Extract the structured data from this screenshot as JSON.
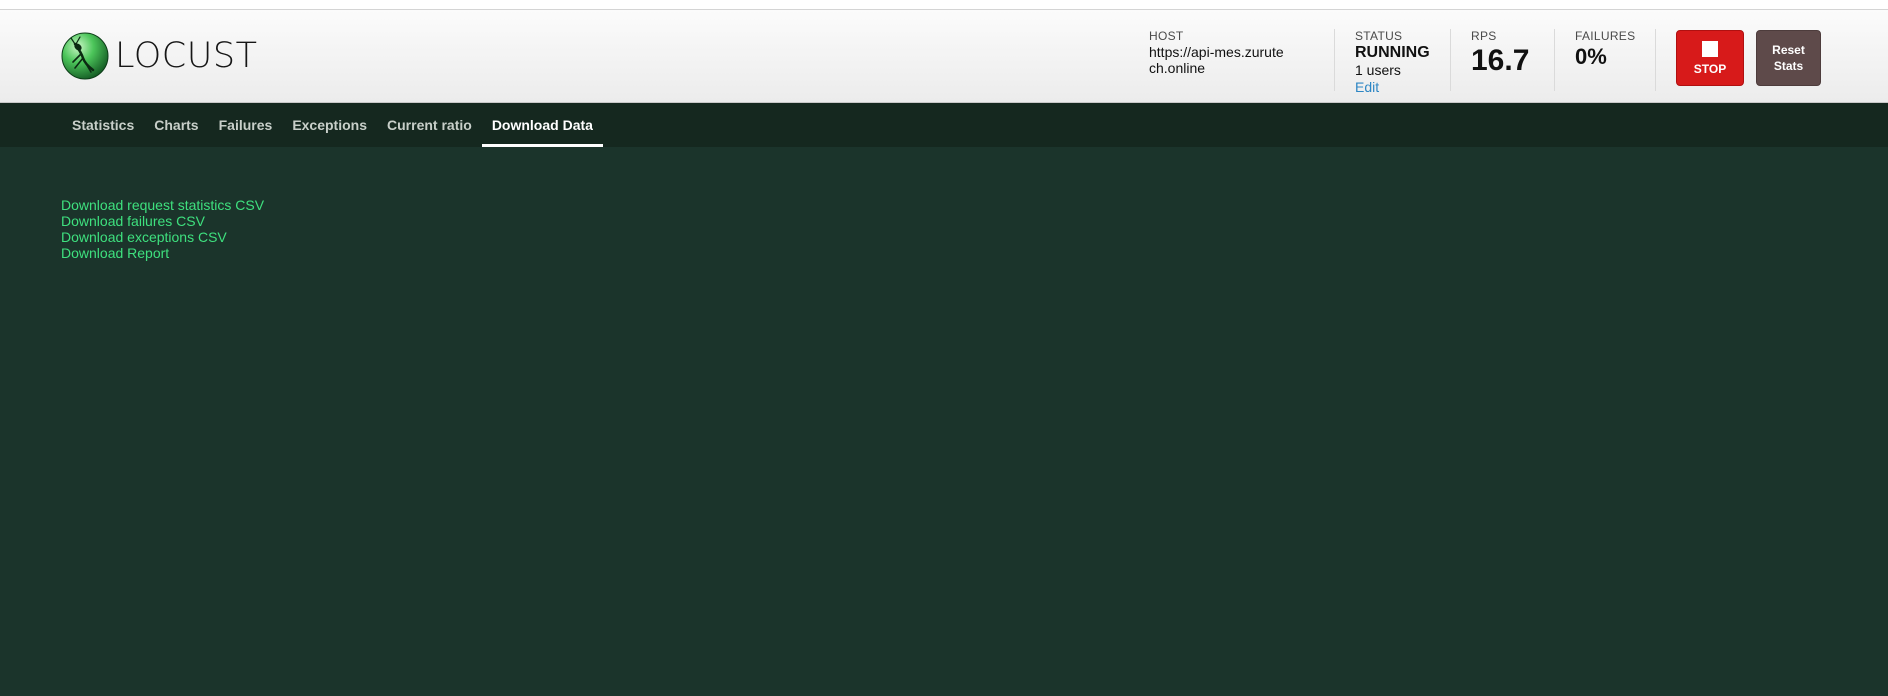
{
  "app": {
    "logo_text": "LOCUST"
  },
  "header": {
    "host": {
      "label": "HOST",
      "value": "https://api-mes.zurutech.online"
    },
    "status": {
      "label": "STATUS",
      "value": "RUNNING",
      "users": "1 users",
      "edit_label": "Edit"
    },
    "rps": {
      "label": "RPS",
      "value": "16.7"
    },
    "failures": {
      "label": "FAILURES",
      "value": "0%"
    },
    "stop_label": "STOP",
    "reset_label": "Reset\nStats"
  },
  "nav": {
    "tabs": [
      {
        "label": "Statistics"
      },
      {
        "label": "Charts"
      },
      {
        "label": "Failures"
      },
      {
        "label": "Exceptions"
      },
      {
        "label": "Current ratio"
      },
      {
        "label": "Download Data"
      }
    ],
    "active_index": 5
  },
  "downloads": {
    "links": [
      {
        "label": "Download request statistics CSV"
      },
      {
        "label": "Download failures CSV"
      },
      {
        "label": "Download exceptions CSV"
      },
      {
        "label": "Download Report"
      }
    ]
  },
  "colors": {
    "background": "#1b342b",
    "nav_background": "#15281f",
    "link": "#3ee07e",
    "stop": "#d71a1a",
    "reset": "#5e4a4a",
    "edit_link": "#2d86c4"
  },
  "icons": {
    "logo": "locust-logo-icon",
    "stop": "stop-square-icon"
  }
}
